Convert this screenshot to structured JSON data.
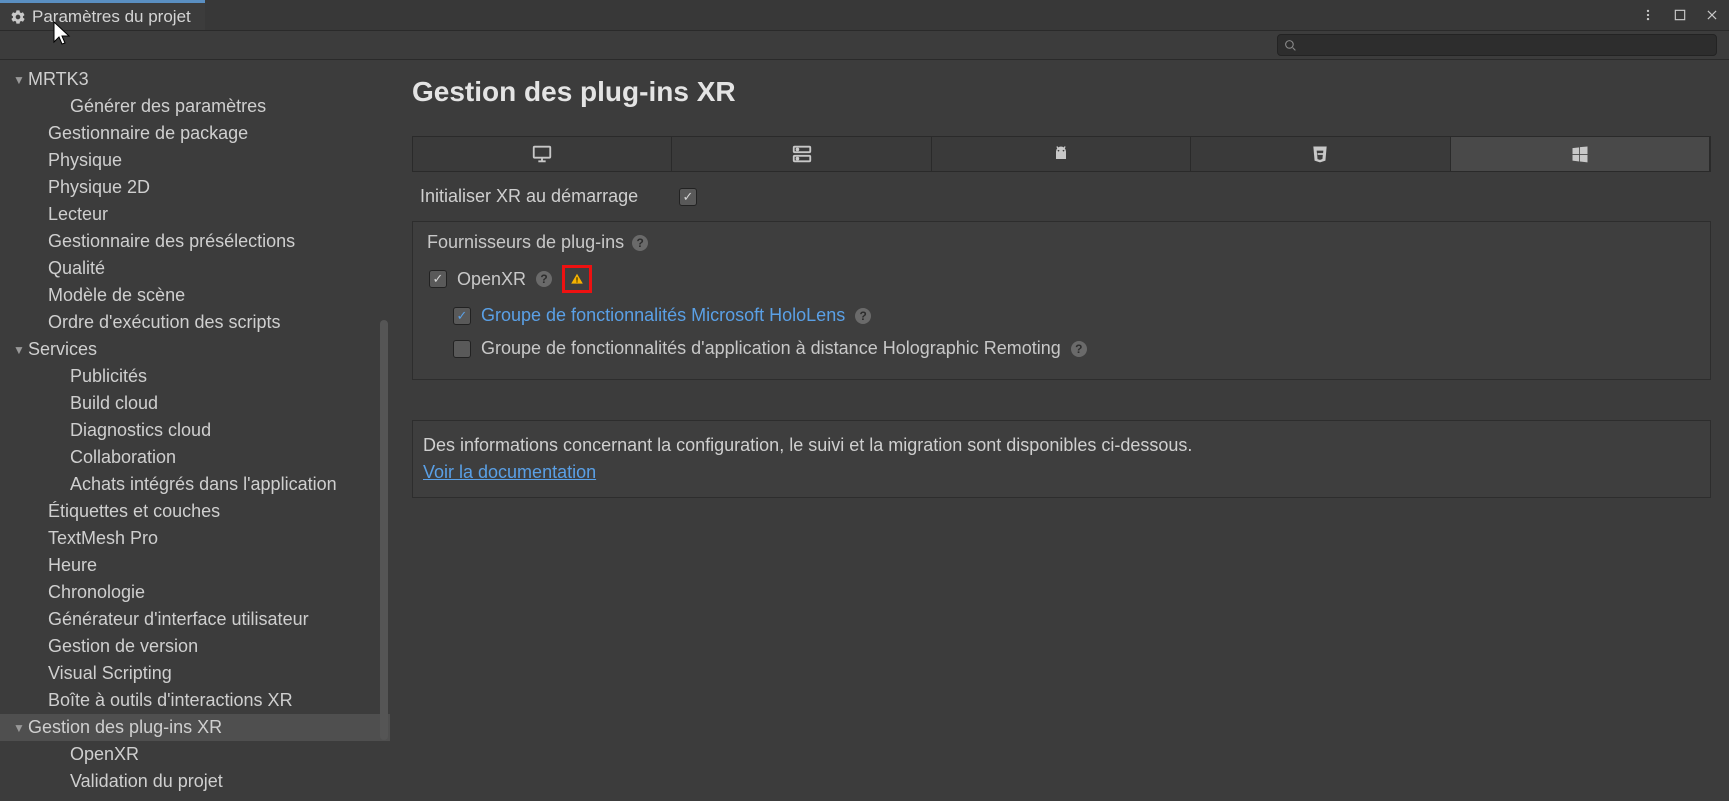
{
  "window": {
    "tab_title": "Paramètres du projet"
  },
  "sidebar": {
    "items": [
      {
        "label": "MRTK3",
        "foldout": true,
        "level": 0
      },
      {
        "label": "Générer des paramètres",
        "level": 2
      },
      {
        "label": "Gestionnaire de package",
        "level": 1
      },
      {
        "label": "Physique",
        "level": 1
      },
      {
        "label": "Physique 2D",
        "level": 1
      },
      {
        "label": "Lecteur",
        "level": 1
      },
      {
        "label": "Gestionnaire des présélections",
        "level": 1
      },
      {
        "label": "Qualité",
        "level": 1
      },
      {
        "label": "Modèle de scène",
        "level": 1
      },
      {
        "label": "Ordre d'exécution des scripts",
        "level": 1
      },
      {
        "label": "Services",
        "foldout": true,
        "level": 0
      },
      {
        "label": "Publicités",
        "level": 2
      },
      {
        "label": "Build cloud",
        "level": 2
      },
      {
        "label": "Diagnostics cloud",
        "level": 2
      },
      {
        "label": "Collaboration",
        "level": 2
      },
      {
        "label": "Achats intégrés dans l'application",
        "level": 2
      },
      {
        "label": "Étiquettes et couches",
        "level": 1
      },
      {
        "label": "TextMesh Pro",
        "level": 1
      },
      {
        "label": "Heure",
        "level": 1
      },
      {
        "label": "Chronologie",
        "level": 1
      },
      {
        "label": "Générateur d'interface utilisateur",
        "level": 1
      },
      {
        "label": "Gestion de version",
        "level": 1
      },
      {
        "label": "Visual Scripting",
        "level": 1
      },
      {
        "label": "Boîte à outils d'interactions XR",
        "level": 1
      },
      {
        "label": "Gestion des plug-ins XR",
        "foldout": true,
        "level": 0,
        "selected": true
      },
      {
        "label": "OpenXR",
        "level": 2
      },
      {
        "label": "Validation du projet",
        "level": 2
      }
    ]
  },
  "content": {
    "title": "Gestion des plug-ins XR",
    "init_label": "Initialiser XR au démarrage",
    "init_checked": true,
    "providers_title": "Fournisseurs de plug-ins",
    "openxr": {
      "label": "OpenXR",
      "checked": true,
      "warning": true
    },
    "hololens": {
      "label": "Groupe de fonctionnalités Microsoft HoloLens",
      "checked": true
    },
    "remoting": {
      "label": "Groupe de fonctionnalités d'application à distance Holographic Remoting",
      "checked": false
    },
    "info_text": "Des informations concernant la configuration, le suivi et la migration sont disponibles ci-dessous.",
    "doc_link": "Voir la documentation"
  },
  "platform_tabs": [
    "desktop",
    "server",
    "android",
    "webgl",
    "windows"
  ],
  "active_platform": "windows"
}
